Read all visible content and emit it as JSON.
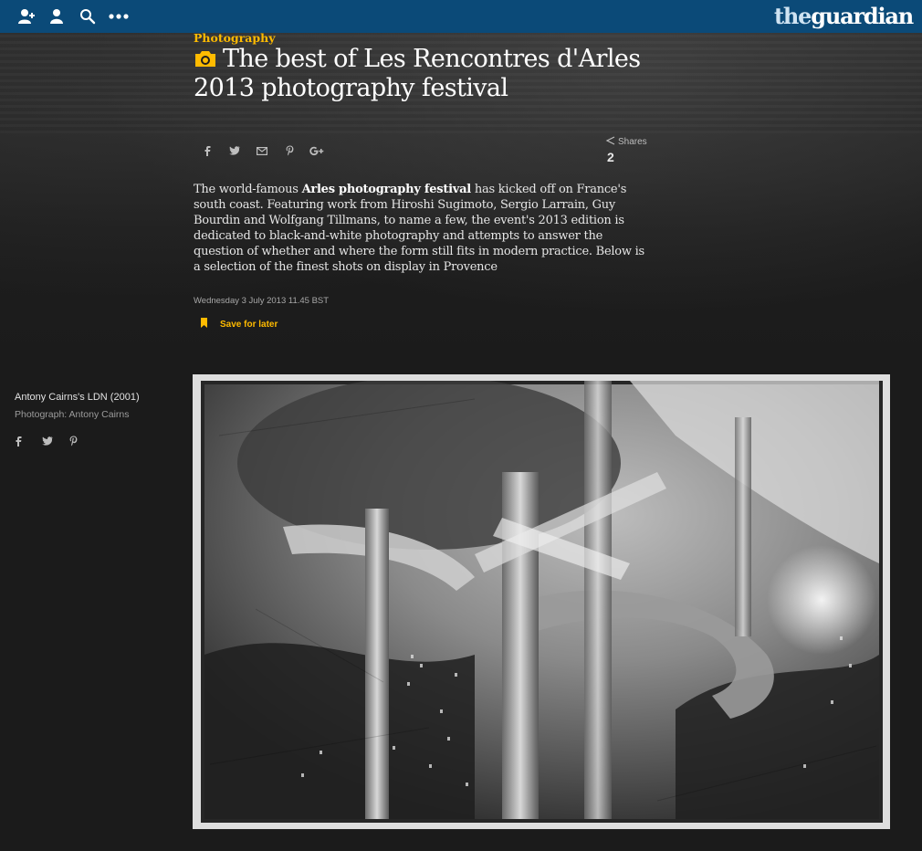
{
  "topbar": {
    "icons": [
      "add-user-icon",
      "profile-icon",
      "search-icon",
      "more-icon"
    ],
    "brand_the": "the",
    "brand_name": "guardian",
    "bg_color": "#0b4a78"
  },
  "article": {
    "section": "Photography",
    "title": "The best of Les Rencontres d'Arles 2013 photography festival",
    "standfirst_before": "The world-famous ",
    "standfirst_link": "Arles photography festival",
    "standfirst_after": " has kicked off on France's south coast. Featuring work from Hiroshi Sugimoto, Sergio Larrain, Guy Bourdin and Wolfgang Tillmans, to name a few, the event's 2013 edition is dedicated to black-and-white photography and attempts to answer the question of whether and where the form still fits in modern practice. Below is a selection of the finest shots on display in Provence",
    "date": "Wednesday 3 July 2013 11.45 BST",
    "save_label": "Save for later",
    "share_icons": [
      "facebook-icon",
      "twitter-icon",
      "email-icon",
      "pinterest-icon",
      "google-plus-icon"
    ],
    "shares_label": "Shares",
    "shares_count": "2",
    "accent_color": "#ffbb00"
  },
  "gallery": {
    "caption_title": "Antony Cairns's LDN (2001)",
    "caption_credit": "Photograph: Antony Cairns",
    "caption_share_icons": [
      "facebook-icon",
      "twitter-icon",
      "pinterest-icon"
    ]
  }
}
